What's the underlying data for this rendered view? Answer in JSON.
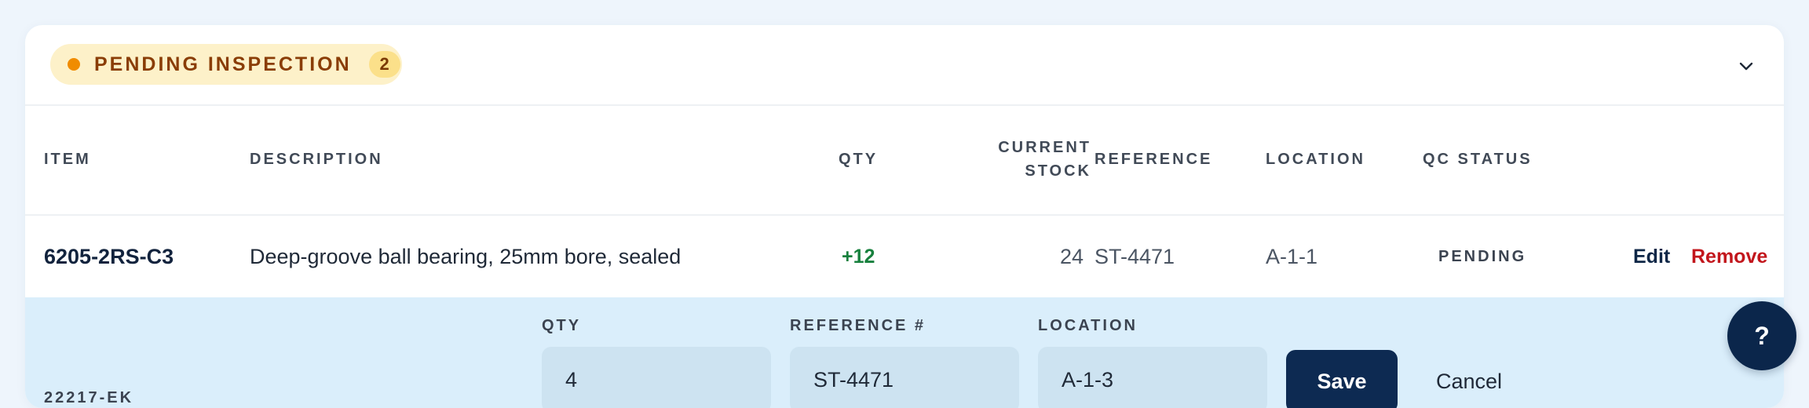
{
  "section": {
    "status_label": "PENDING INSPECTION",
    "status_count": "2",
    "status_color": "#f08c00",
    "collapse_icon": "chevron-down-icon"
  },
  "table": {
    "headers": {
      "item": "ITEM",
      "description": "DESCRIPTION",
      "qty": "QTY",
      "current_stock_line1": "CURRENT",
      "current_stock_line2": "STOCK",
      "reference": "REFERENCE",
      "location": "LOCATION",
      "qc_status": "QC STATUS"
    },
    "rows": [
      {
        "item": "6205-2RS-C3",
        "description": "Deep-groove ball bearing, 25mm bore, sealed",
        "qty": "+12",
        "current_stock": "24",
        "reference": "ST-4471",
        "location": "A-1-1",
        "qc_status": "PENDING",
        "edit_label": "Edit",
        "remove_label": "Remove"
      }
    ]
  },
  "edit_form": {
    "item": "22217-EK",
    "qty_label": "QTY",
    "qty_value": "4",
    "reference_label": "REFERENCE #",
    "reference_value": "ST-4471",
    "location_label": "LOCATION",
    "location_value": "A-1-3",
    "save_label": "Save",
    "cancel_label": "Cancel"
  },
  "help": {
    "label": "?"
  }
}
